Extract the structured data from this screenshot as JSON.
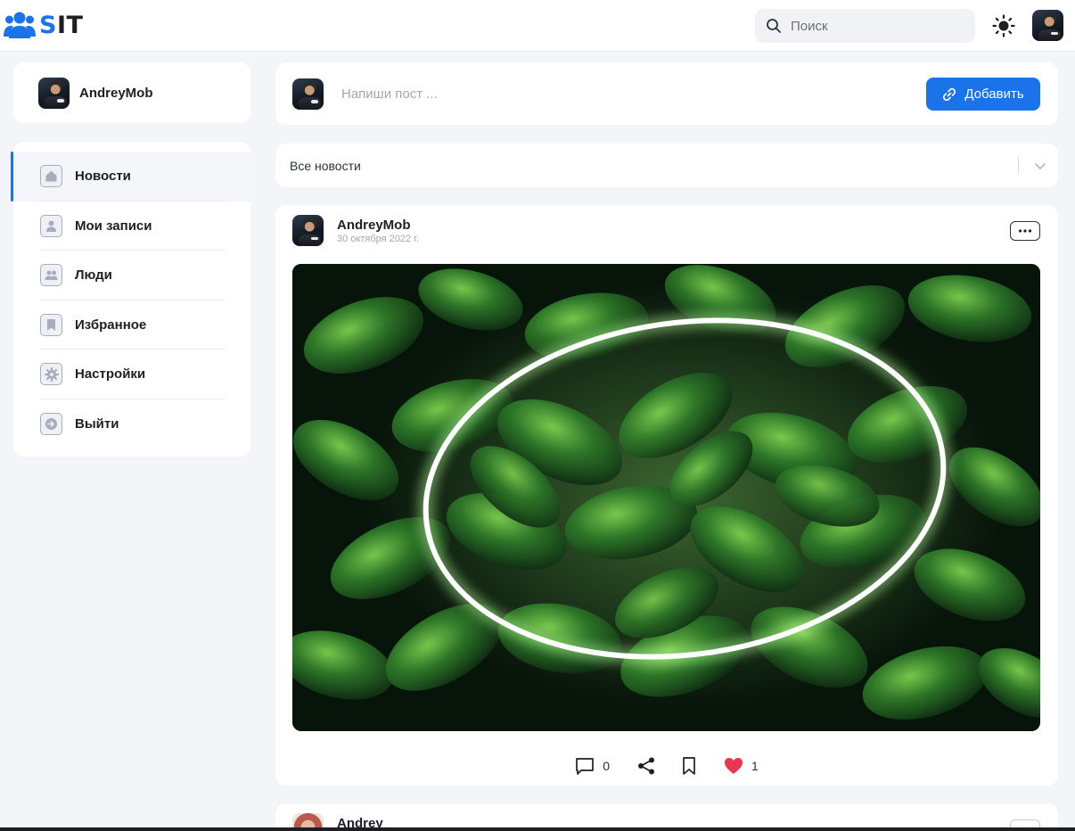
{
  "brand": {
    "name_blue": "S",
    "name_rest": "IT",
    "accent": "#1a73e8"
  },
  "header": {
    "search_placeholder": "Поиск",
    "theme_icon": "sun-icon"
  },
  "profile": {
    "username": "AndreyMob"
  },
  "sidebar": {
    "items": [
      {
        "label": "Новости",
        "icon": "home-icon",
        "active": true
      },
      {
        "label": "Мои записи",
        "icon": "user-icon",
        "active": false
      },
      {
        "label": "Люди",
        "icon": "people-icon",
        "active": false
      },
      {
        "label": "Избранное",
        "icon": "bookmark-icon",
        "active": false
      },
      {
        "label": "Настройки",
        "icon": "gear-icon",
        "active": false
      },
      {
        "label": "Выйти",
        "icon": "logout-icon",
        "active": false
      }
    ]
  },
  "composer": {
    "placeholder": "Напиши пост ...",
    "add_label": "Добавить"
  },
  "filter": {
    "selected": "Все новости"
  },
  "posts": [
    {
      "author": "AndreyMob",
      "date": "30 октября 2022 г.",
      "comments": "0",
      "likes": "1",
      "like_color": "#e8384f"
    },
    {
      "author": "Andrey"
    }
  ]
}
